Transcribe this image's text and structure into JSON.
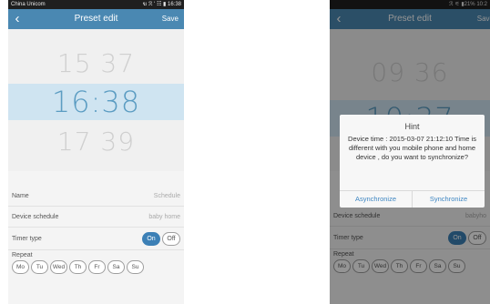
{
  "left": {
    "status": {
      "carrier": "China Unicom",
      "icons": "ฆ ℛ ʹ ☷ ▮",
      "time": "16:38"
    },
    "header": {
      "back_icon": "chevron-left-icon",
      "title": "Preset edit",
      "save_label": "Save"
    },
    "picker": {
      "prev": "15 37",
      "selected": "16:38",
      "next": "17 39"
    },
    "settings": {
      "name_label": "Name",
      "name_value": "Schedule",
      "device_label": "Device schedule",
      "device_value": "baby home",
      "timer_label": "Timer type",
      "on_label": "On",
      "off_label": "Off",
      "repeat_label": "Repeat",
      "days": [
        "Mo",
        "Tu",
        "Wed",
        "Th",
        "Fr",
        "Sa",
        "Su"
      ]
    }
  },
  "right": {
    "status": {
      "icons": "ℛ ⚟ ▮21%",
      "time": "10:2"
    },
    "header": {
      "title": "Preset edit",
      "save_label": "Save"
    },
    "picker": {
      "prev": "09 36",
      "selected": "10:37"
    },
    "settings": {
      "device_label": "Device schedule",
      "device_value": "babyho",
      "timer_label": "Timer type",
      "on_label": "On",
      "off_label": "Off",
      "repeat_label": "Repeat",
      "days": [
        "Mo",
        "Tu",
        "Wed",
        "Th",
        "Fr",
        "Sa",
        "Su"
      ]
    },
    "dialog": {
      "title": "Hint",
      "message": "Device time : 2015-03-07 21:12:10 Time is different with you mobile phone and home device , do you want to synchronize?",
      "btn_async": "Asynchronize",
      "btn_sync": "Synchronize"
    }
  },
  "colors": {
    "accent": "#4a88b2",
    "selected_band": "#cfe4f1",
    "on_button": "#3c80b6",
    "dialog_button_text": "#3e86c2"
  }
}
